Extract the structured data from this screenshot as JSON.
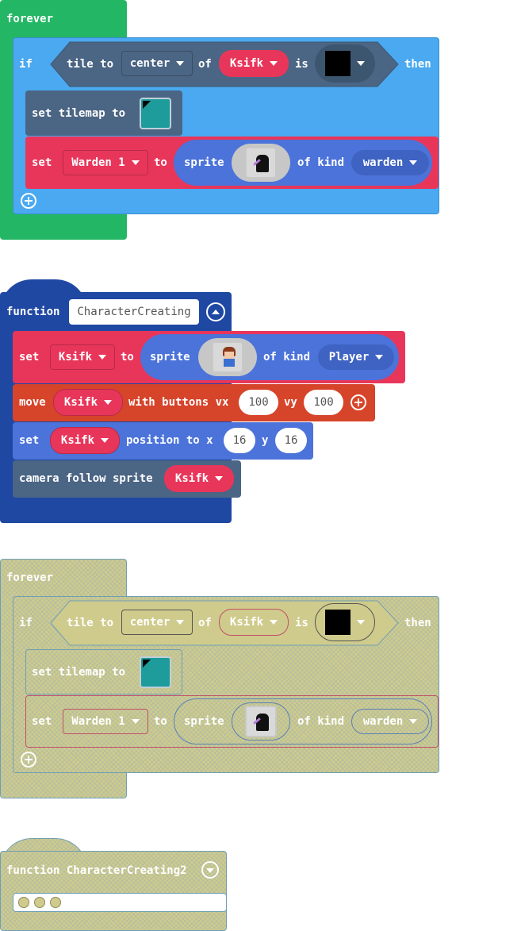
{
  "group1": {
    "forever_label": "forever",
    "if_label": "if",
    "tile_to": "tile to",
    "center": "center",
    "of": "of",
    "ksifk": "Ksifk",
    "is": "is",
    "then": "then",
    "set_tilemap_to": "set tilemap to",
    "set": "set",
    "warden1": "Warden 1",
    "to": "to",
    "sprite": "sprite",
    "of_kind": "of kind",
    "warden": "warden"
  },
  "group2": {
    "function_label": "function",
    "function_name": "CharacterCreating",
    "set": "set",
    "ksifk": "Ksifk",
    "to": "to",
    "sprite": "sprite",
    "of_kind": "of kind",
    "player": "Player",
    "move": "move",
    "with_buttons_vx": "with buttons vx",
    "vx_value": "100",
    "vy": "vy",
    "vy_value": "100",
    "position_to_x": "position to x",
    "x_value": "16",
    "y": "y",
    "y_value": "16",
    "camera_follow_sprite": "camera follow sprite"
  },
  "group3": {
    "forever_label": "forever",
    "if_label": "if",
    "tile_to": "tile to",
    "center": "center",
    "of": "of",
    "ksifk": "Ksifk",
    "is": "is",
    "then": "then",
    "set_tilemap_to": "set tilemap to",
    "set": "set",
    "warden1": "Warden 1",
    "to": "to",
    "sprite": "sprite",
    "of_kind": "of kind",
    "warden": "warden"
  },
  "group4": {
    "function_label": "function CharacterCreating2"
  },
  "colors": {
    "loops_green": "#23b765",
    "logic_blue": "#4aa9f0",
    "scene_slate": "#4b6584",
    "sprites_blue": "#4b73d9",
    "variable_red": "#e8365b",
    "functions_navy": "#1f48a3",
    "controller_orange": "#d6442a",
    "disabled_khaki": "#cfcb8c"
  }
}
